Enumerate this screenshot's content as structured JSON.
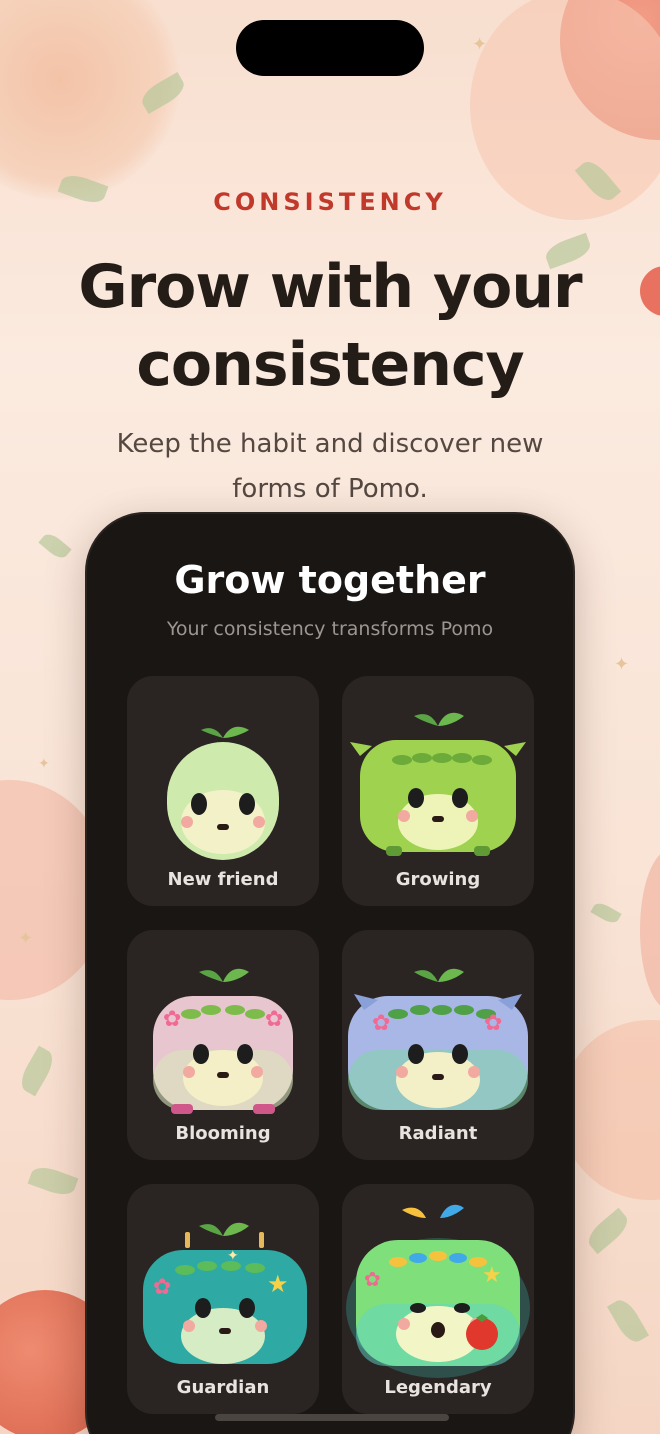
{
  "onboarding": {
    "eyebrow": "CONSISTENCY",
    "headline": "Grow with your consistency",
    "subtitle": "Keep the habit and discover new forms of Pomo."
  },
  "phone": {
    "title": "Grow together",
    "subtitle": "Your consistency transforms Pomo",
    "stages": [
      {
        "label": "New friend",
        "body_color": "#cfeaad",
        "icon": "pomo-new-friend-icon"
      },
      {
        "label": "Growing",
        "body_color": "#9fd24f",
        "icon": "pomo-growing-icon"
      },
      {
        "label": "Blooming",
        "body_color": "#e8c6d0",
        "icon": "pomo-blooming-icon"
      },
      {
        "label": "Radiant",
        "body_color": "#a9b7e6",
        "icon": "pomo-radiant-icon"
      },
      {
        "label": "Guardian",
        "body_color": "#2fa9a3",
        "icon": "pomo-guardian-icon"
      },
      {
        "label": "Legendary",
        "body_color": "#7fe07b",
        "icon": "pomo-legendary-icon"
      }
    ]
  },
  "colors": {
    "accent": "#c0392b",
    "headline": "#231c17",
    "phone_bg": "#1a1614",
    "card_bg": "#2a2523"
  }
}
